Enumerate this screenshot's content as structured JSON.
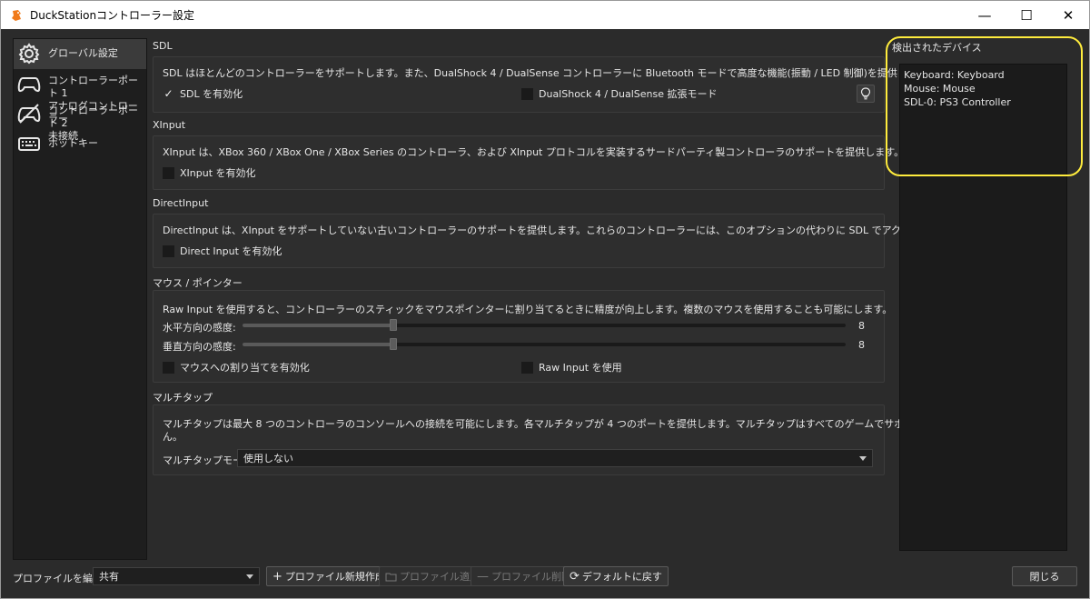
{
  "window": {
    "title": "DuckStationコントローラー設定",
    "minimize_glyph": "—",
    "maximize_glyph": "☐",
    "close_glyph": "✕"
  },
  "sidebar": {
    "items": [
      {
        "label": "グローバル設定",
        "icon": "gear-icon"
      },
      {
        "label1": "コントローラーポート 1",
        "label2": "アナログコントローラー",
        "icon": "gamepad-icon"
      },
      {
        "label1": "コントローラーポート 2",
        "label2": "未接続",
        "icon": "gamepad-disconnected-icon"
      },
      {
        "label": "ホットキー",
        "icon": "keyboard-icon"
      }
    ]
  },
  "sdl": {
    "title": "SDL",
    "description": "SDL はほとんどのコントローラーをサポートします。また、DualShock 4 / DualSense コントローラーに Bluetooth モードで高度な機能(振動 / LED 制御)を提供します。",
    "enable_label": "SDL を有効化",
    "enable_checked": true,
    "ds4_label": "DualShock 4 / DualSense 拡張モード",
    "ds4_checked": false
  },
  "xinput": {
    "title": "XInput",
    "description": "XInput は、XBox 360 / XBox One / XBox Series のコントローラ、および XInput プロトコルを実装するサードパーティ製コントローラのサポートを提供します。",
    "enable_label": "XInput を有効化"
  },
  "directinput": {
    "title": "DirectInput",
    "description": "DirectInput は、XInput をサポートしていない古いコントローラーのサポートを提供します。これらのコントローラーには、このオプションの代わりに SDL でアクセスすることをお勧めします。",
    "enable_label": "Direct Input を有効化"
  },
  "mouse": {
    "title": "マウス / ポインター",
    "description": "Raw Input を使用すると、コントローラーのスティックをマウスポインターに割り当てるときに精度が向上します。複数のマウスを使用することも可能にします。",
    "h_label": "水平方向の感度:",
    "h_value": "8",
    "v_label": "垂直方向の感度:",
    "v_value": "8",
    "slider_fraction": 0.25,
    "mapping_label": "マウスへの割り当てを有効化",
    "rawinput_label": "Raw Input を使用"
  },
  "multitap": {
    "title": "マルチタップ",
    "description_line1": "マルチタップは最大 8 つのコントローラのコンソールへの接続を可能にします。各マルチタップが 4 つのポートを提供します。マルチタップはすべてのゲームでサポートされているわけではありませ",
    "description_line2": "ん。",
    "mode_label": "マルチタップモード:",
    "mode_value": "使用しない"
  },
  "devices": {
    "title": "検出されたデバイス",
    "items": [
      "Keyboard: Keyboard",
      "Mouse: Mouse",
      "SDL-0: PS3 Controller"
    ]
  },
  "bottom": {
    "profile_label": "プロファイルを編集:",
    "profile_value": "共有",
    "new_profile": "プロファイル新規作成",
    "apply_profile": "プロファイル適用",
    "delete_profile": "プロファイル削除",
    "restore_defaults": "デフォルトに戻す",
    "close": "閉じる"
  },
  "colors": {
    "highlight": "#ffec3d",
    "background": "#2b2b2b"
  }
}
